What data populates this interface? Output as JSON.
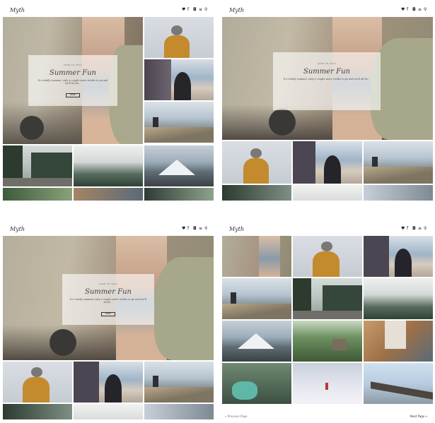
{
  "site": {
    "logo": "Myth"
  },
  "header_icons": [
    "twitter-icon",
    "facebook-icon",
    "instagram-icon",
    "menu-icon",
    "search-icon"
  ],
  "featured": {
    "date": "JUNE 18, 2015",
    "title": "Summer Fun",
    "excerpt": "It's totally summer, only a couple more weeks to go and we'll all be...",
    "button": "MORE"
  },
  "pagination": {
    "prev": "« Previous Page",
    "next": "Next Page »"
  },
  "colors": {
    "accent": "#c96b3a",
    "text": "#333333"
  }
}
